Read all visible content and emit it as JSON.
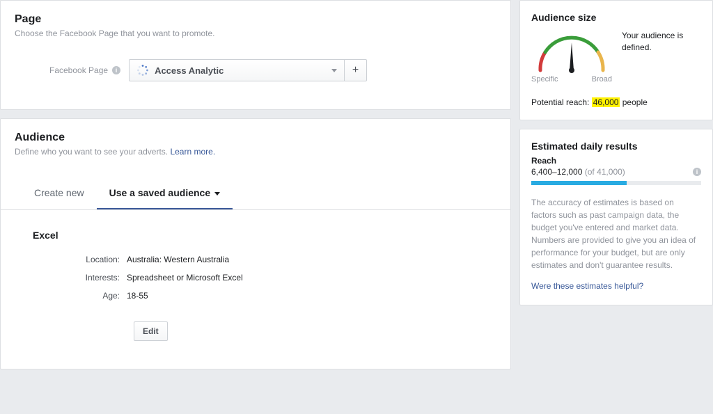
{
  "page": {
    "title": "Page",
    "subtitle": "Choose the Facebook Page that you want to promote.",
    "field_label": "Facebook Page",
    "selected_page": "Access Analytic",
    "plus_label": "+"
  },
  "audience": {
    "title": "Audience",
    "subtitle_prefix": "Define who you want to see your adverts. ",
    "learn_more": "Learn more.",
    "tabs": {
      "create_new": "Create new",
      "saved": "Use a saved audience"
    },
    "saved": {
      "name": "Excel",
      "rows": [
        {
          "label": "Location:",
          "value": "Australia: Western Australia"
        },
        {
          "label": "Interests:",
          "value": "Spreadsheet or Microsoft Excel"
        },
        {
          "label": "Age:",
          "value": "18-55"
        }
      ],
      "edit_label": "Edit"
    }
  },
  "size": {
    "title": "Audience size",
    "defined_text": "Your audience is defined.",
    "gauge_specific": "Specific",
    "gauge_broad": "Broad",
    "potential_prefix": "Potential reach: ",
    "potential_value": "46,000",
    "potential_suffix": " people"
  },
  "estimated": {
    "title": "Estimated daily results",
    "reach_heading": "Reach",
    "reach_value": "6,400–12,000",
    "reach_of": "(of 41,000)",
    "disclaimer": "The accuracy of estimates is based on factors such as past campaign data, the budget you've entered and market data. Numbers are provided to give you an idea of performance for your budget, but are only estimates and don't guarantee results.",
    "feedback": "Were these estimates helpful?"
  }
}
